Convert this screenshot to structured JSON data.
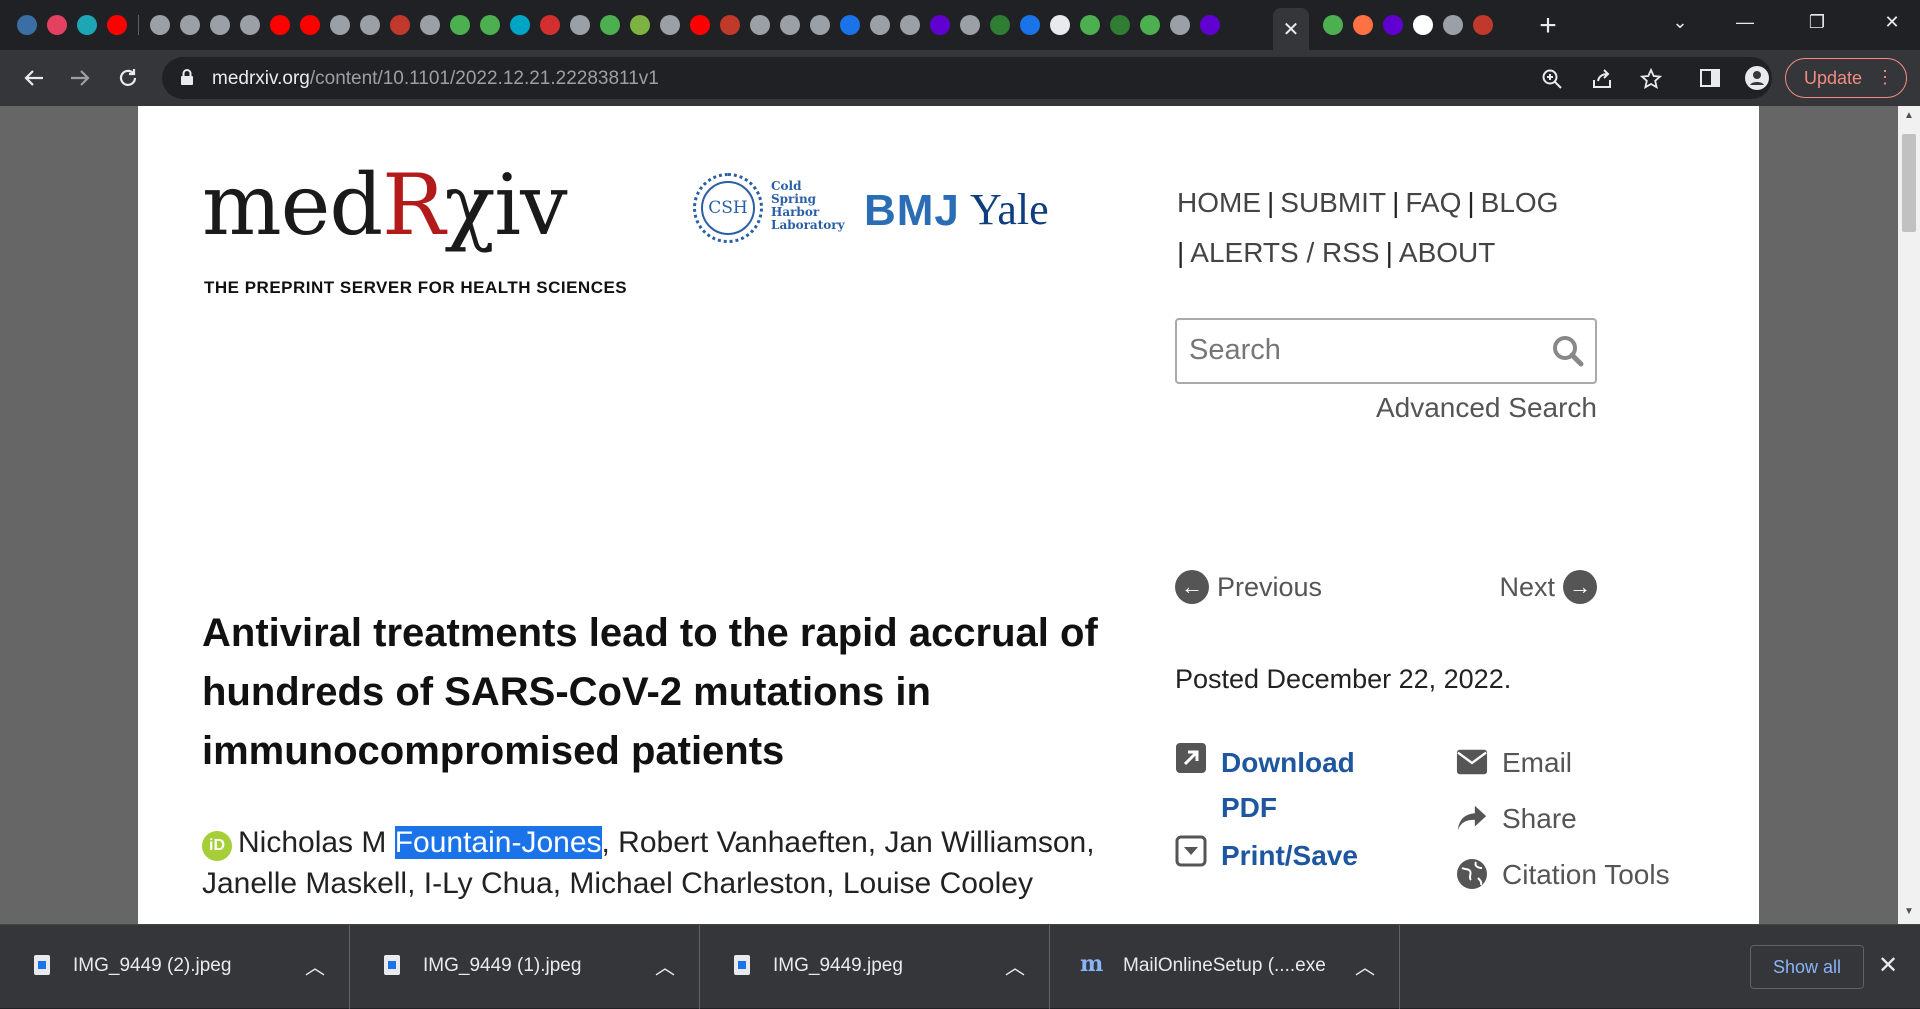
{
  "browser": {
    "tab_favicon_colors": [
      "#3b6ea5",
      "#e4405f",
      "#1ea6b5",
      "#ff0000",
      "#9aa0a6",
      "#9aa0a6",
      "#9aa0a6",
      "#9aa0a6",
      "#ff0000",
      "#ff0000",
      "#9aa0a6",
      "#9aa0a6",
      "#c0392b",
      "#9aa0a6",
      "#4caf50",
      "#4caf50",
      "#00a4c4",
      "#d32f2f",
      "#9aa0a6",
      "#4caf50",
      "#7cb342",
      "#9aa0a6",
      "#ff0000",
      "#c0392b",
      "#9aa0a6",
      "#9aa0a6",
      "#9aa0a6",
      "#1a73e8",
      "#9aa0a6",
      "#9aa0a6",
      "#6001d2",
      "#9aa0a6",
      "#2e7d32",
      "#1a73e8",
      "#e8eaed",
      "#4caf50",
      "#2e7d32",
      "#4caf50",
      "#9aa0a6",
      "#6001d2"
    ],
    "tab_favicon_colors_after": [
      "#4caf50",
      "#ff7043",
      "#6001d2",
      "#ffffff",
      "#9aa0a6",
      "#c0392b"
    ],
    "active_tab_close": "✕",
    "new_tab": "+",
    "window_controls": [
      "⌄",
      "—",
      "❐",
      "✕"
    ],
    "url_host": "medrxiv.org",
    "url_path": "/content/10.1101/2022.12.21.22283811v1",
    "update_label": "Update"
  },
  "site": {
    "logo_med": "med",
    "logo_r": "R",
    "logo_xiv": "χiv",
    "tagline": "THE PREPRINT SERVER FOR HEALTH SCIENCES",
    "partner_csh": "CSH",
    "partner_csh_text": [
      "Cold",
      "Spring",
      "Harbor",
      "Laboratory"
    ],
    "partner_bmj": "BMJ",
    "partner_yale": "Yale",
    "nav": [
      "HOME",
      "SUBMIT",
      "FAQ",
      "BLOG",
      "ALERTS / RSS",
      "ABOUT"
    ],
    "search_placeholder": "Search",
    "advanced_search": "Advanced Search",
    "previous": "Previous",
    "next": "Next",
    "posted": "Posted December 22, 2022."
  },
  "article": {
    "title": "Antiviral treatments lead to the rapid accrual of hundreds of SARS-CoV-2 mutations in immunocompromised patients",
    "orcid_badge": "iD",
    "author_first": "Nicholas M ",
    "author_highlight": "Fountain-Jones",
    "authors_rest": ", Robert Vanhaeften, Jan Williamson, Janelle Maskell, I-Ly Chua, Michael Charleston, Louise Cooley",
    "actions": {
      "download_pdf": "Download PDF",
      "print_save": "Print/Save",
      "email": "Email",
      "share": "Share",
      "citation_tools": "Citation Tools"
    }
  },
  "downloads": {
    "items": [
      "IMG_9449 (2).jpeg",
      "IMG_9449 (1).jpeg",
      "IMG_9449.jpeg",
      "MailOnlineSetup (....exe"
    ],
    "mail_icon_letter": "m",
    "show_all": "Show all"
  }
}
